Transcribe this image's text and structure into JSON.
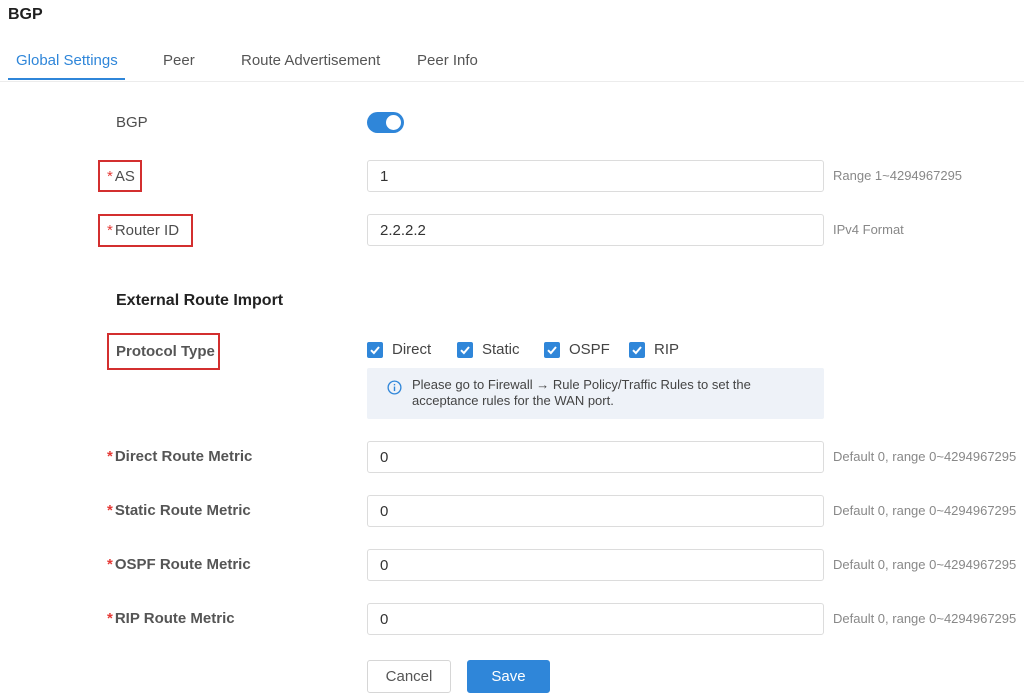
{
  "page": {
    "title": "BGP"
  },
  "tabs": [
    {
      "label": "Global Settings",
      "active": true
    },
    {
      "label": "Peer",
      "active": false
    },
    {
      "label": "Route Advertisement",
      "active": false
    },
    {
      "label": "Peer Info",
      "active": false
    }
  ],
  "bgp": {
    "label": "BGP",
    "enabled": true
  },
  "as_field": {
    "required_mark": "*",
    "label": "AS",
    "value": "1",
    "hint": "Range 1~4294967295"
  },
  "router_id": {
    "required_mark": "*",
    "label": "Router ID",
    "value": "2.2.2.2",
    "hint": "IPv4 Format"
  },
  "external_route_import": {
    "title": "External Route Import",
    "protocol_type": {
      "label": "Protocol Type",
      "options": [
        {
          "label": "Direct",
          "checked": true
        },
        {
          "label": "Static",
          "checked": true
        },
        {
          "label": "OSPF",
          "checked": true
        },
        {
          "label": "RIP",
          "checked": true
        }
      ]
    },
    "notice": "Please go to Firewall → Rule Policy/Traffic Rules to set the acceptance rules for the WAN port."
  },
  "metrics": [
    {
      "required_mark": "*",
      "label": "Direct Route Metric",
      "value": "0",
      "hint": "Default 0, range 0~4294967295"
    },
    {
      "required_mark": "*",
      "label": "Static Route Metric",
      "value": "0",
      "hint": "Default 0, range 0~4294967295"
    },
    {
      "required_mark": "*",
      "label": "OSPF Route Metric",
      "value": "0",
      "hint": "Default 0, range 0~4294967295"
    },
    {
      "required_mark": "*",
      "label": "RIP Route Metric",
      "value": "0",
      "hint": "Default 0, range 0~4294967295"
    }
  ],
  "buttons": {
    "cancel": "Cancel",
    "save": "Save"
  },
  "colors": {
    "accent": "#2f86d9",
    "highlight": "#d32f2f",
    "required": "#e53935"
  }
}
